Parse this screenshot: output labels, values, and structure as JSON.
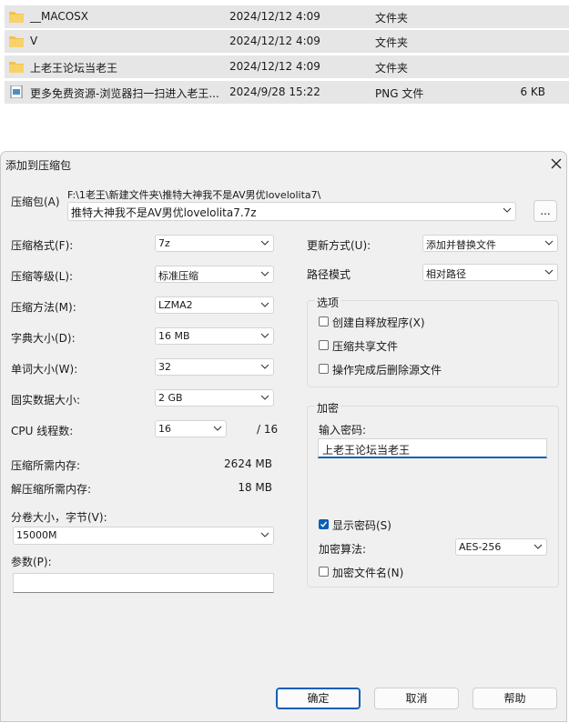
{
  "file_list": [
    {
      "icon": "folder-icon",
      "name": "__MACOSX",
      "date": "2024/12/12 4:09",
      "type": "文件夹",
      "size": ""
    },
    {
      "icon": "folder-icon",
      "name": "V",
      "date": "2024/12/12 4:09",
      "type": "文件夹",
      "size": ""
    },
    {
      "icon": "folder-icon",
      "name": "上老王论坛当老王",
      "date": "2024/12/12 4:09",
      "type": "文件夹",
      "size": ""
    },
    {
      "icon": "image-file-icon",
      "name": "更多免费资源-浏览器扫一扫进入老王...",
      "date": "2024/9/28 15:22",
      "type": "PNG 文件",
      "size": "6 KB"
    }
  ],
  "dialog": {
    "title": "添加到压缩包",
    "archive_label": "压缩包(A)",
    "archive_path": "F:\\1老王\\新建文件夹\\推特大神我不是AV男优lovelolita7\\",
    "archive_name": "推特大神我不是AV男优lovelolita7.7z",
    "browse_label": "...",
    "fields": {
      "format": {
        "label": "压缩格式(F):",
        "value": "7z"
      },
      "level": {
        "label": "压缩等级(L):",
        "value": "标准压缩"
      },
      "method": {
        "label": "压缩方法(M):",
        "value": "LZMA2"
      },
      "dict": {
        "label": "字典大小(D):",
        "value": "16 MB"
      },
      "word": {
        "label": "单词大小(W):",
        "value": "32"
      },
      "solid": {
        "label": "固实数据大小:",
        "value": "2 GB"
      },
      "threads": {
        "label": "CPU 线程数:",
        "value": "16",
        "total": "/ 16"
      }
    },
    "mem_compress": {
      "label": "压缩所需内存:",
      "value": "2624 MB"
    },
    "mem_decompress": {
      "label": "解压缩所需内存:",
      "value": "18 MB"
    },
    "volume": {
      "label": "分卷大小，字节(V):",
      "value": "15000M"
    },
    "params_label": "参数(P):",
    "update": {
      "label": "更新方式(U):",
      "value": "添加并替换文件"
    },
    "path_mode": {
      "label": "路径模式",
      "value": "相对路径"
    },
    "options": {
      "title": "选项",
      "items": [
        {
          "label": "创建自释放程序(X)",
          "checked": false
        },
        {
          "label": "压缩共享文件",
          "checked": false
        },
        {
          "label": "操作完成后删除源文件",
          "checked": false
        }
      ]
    },
    "encryption": {
      "title": "加密",
      "password_label": "输入密码:",
      "password_value": "上老王论坛当老王",
      "show_password": {
        "label": "显示密码(S)",
        "checked": true
      },
      "method_label": "加密算法:",
      "method_value": "AES-256",
      "encrypt_names": {
        "label": "加密文件名(N)",
        "checked": false
      }
    },
    "buttons": {
      "ok": "确定",
      "cancel": "取消",
      "help": "帮助"
    }
  },
  "colors": {
    "accent": "#0a5fb4",
    "folder": "#f2c14e",
    "row_bg": "#e6e6e6",
    "dialog_bg": "#f0f0f0"
  }
}
